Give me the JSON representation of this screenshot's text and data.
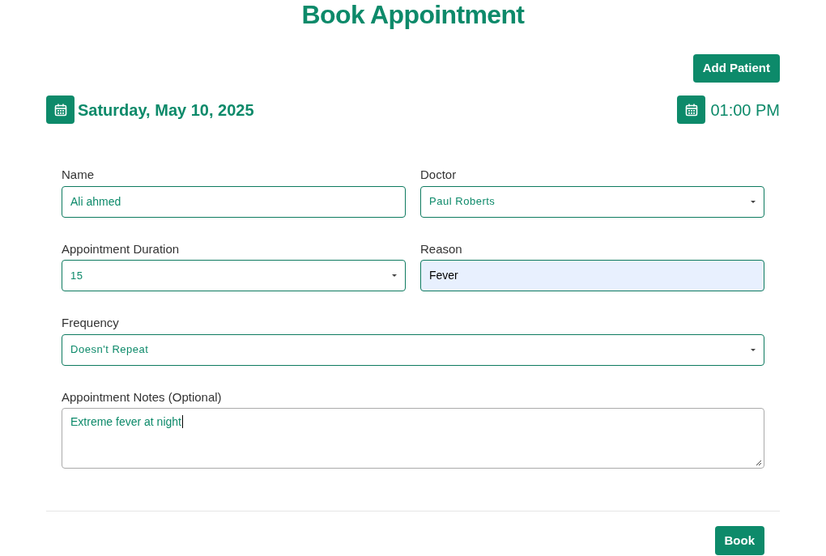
{
  "title": "Book Appointment",
  "add_patient_button": "Add Patient",
  "date": "Saturday, May 10, 2025",
  "time": "01:00 PM",
  "fields": [
    {
      "kind": "input",
      "label": "Name",
      "value": "Ali ahmed",
      "highlighted": false,
      "wide": false
    },
    {
      "kind": "select",
      "label": "Doctor",
      "value": "Paul Roberts",
      "highlighted": false,
      "wide": false
    },
    {
      "kind": "select",
      "label": "Appointment Duration",
      "value": "15",
      "highlighted": false,
      "wide": false
    },
    {
      "kind": "input",
      "label": "Reason",
      "value": "Fever",
      "highlighted": true,
      "wide": false
    },
    {
      "kind": "select",
      "label": "Frequency",
      "value": "Doesn't Repeat",
      "highlighted": false,
      "wide": true
    },
    {
      "kind": "textarea",
      "label": "Appointment Notes (Optional)",
      "value": "Extreme fever at night",
      "highlighted": false,
      "wide": true
    }
  ],
  "submit_button": "Book"
}
